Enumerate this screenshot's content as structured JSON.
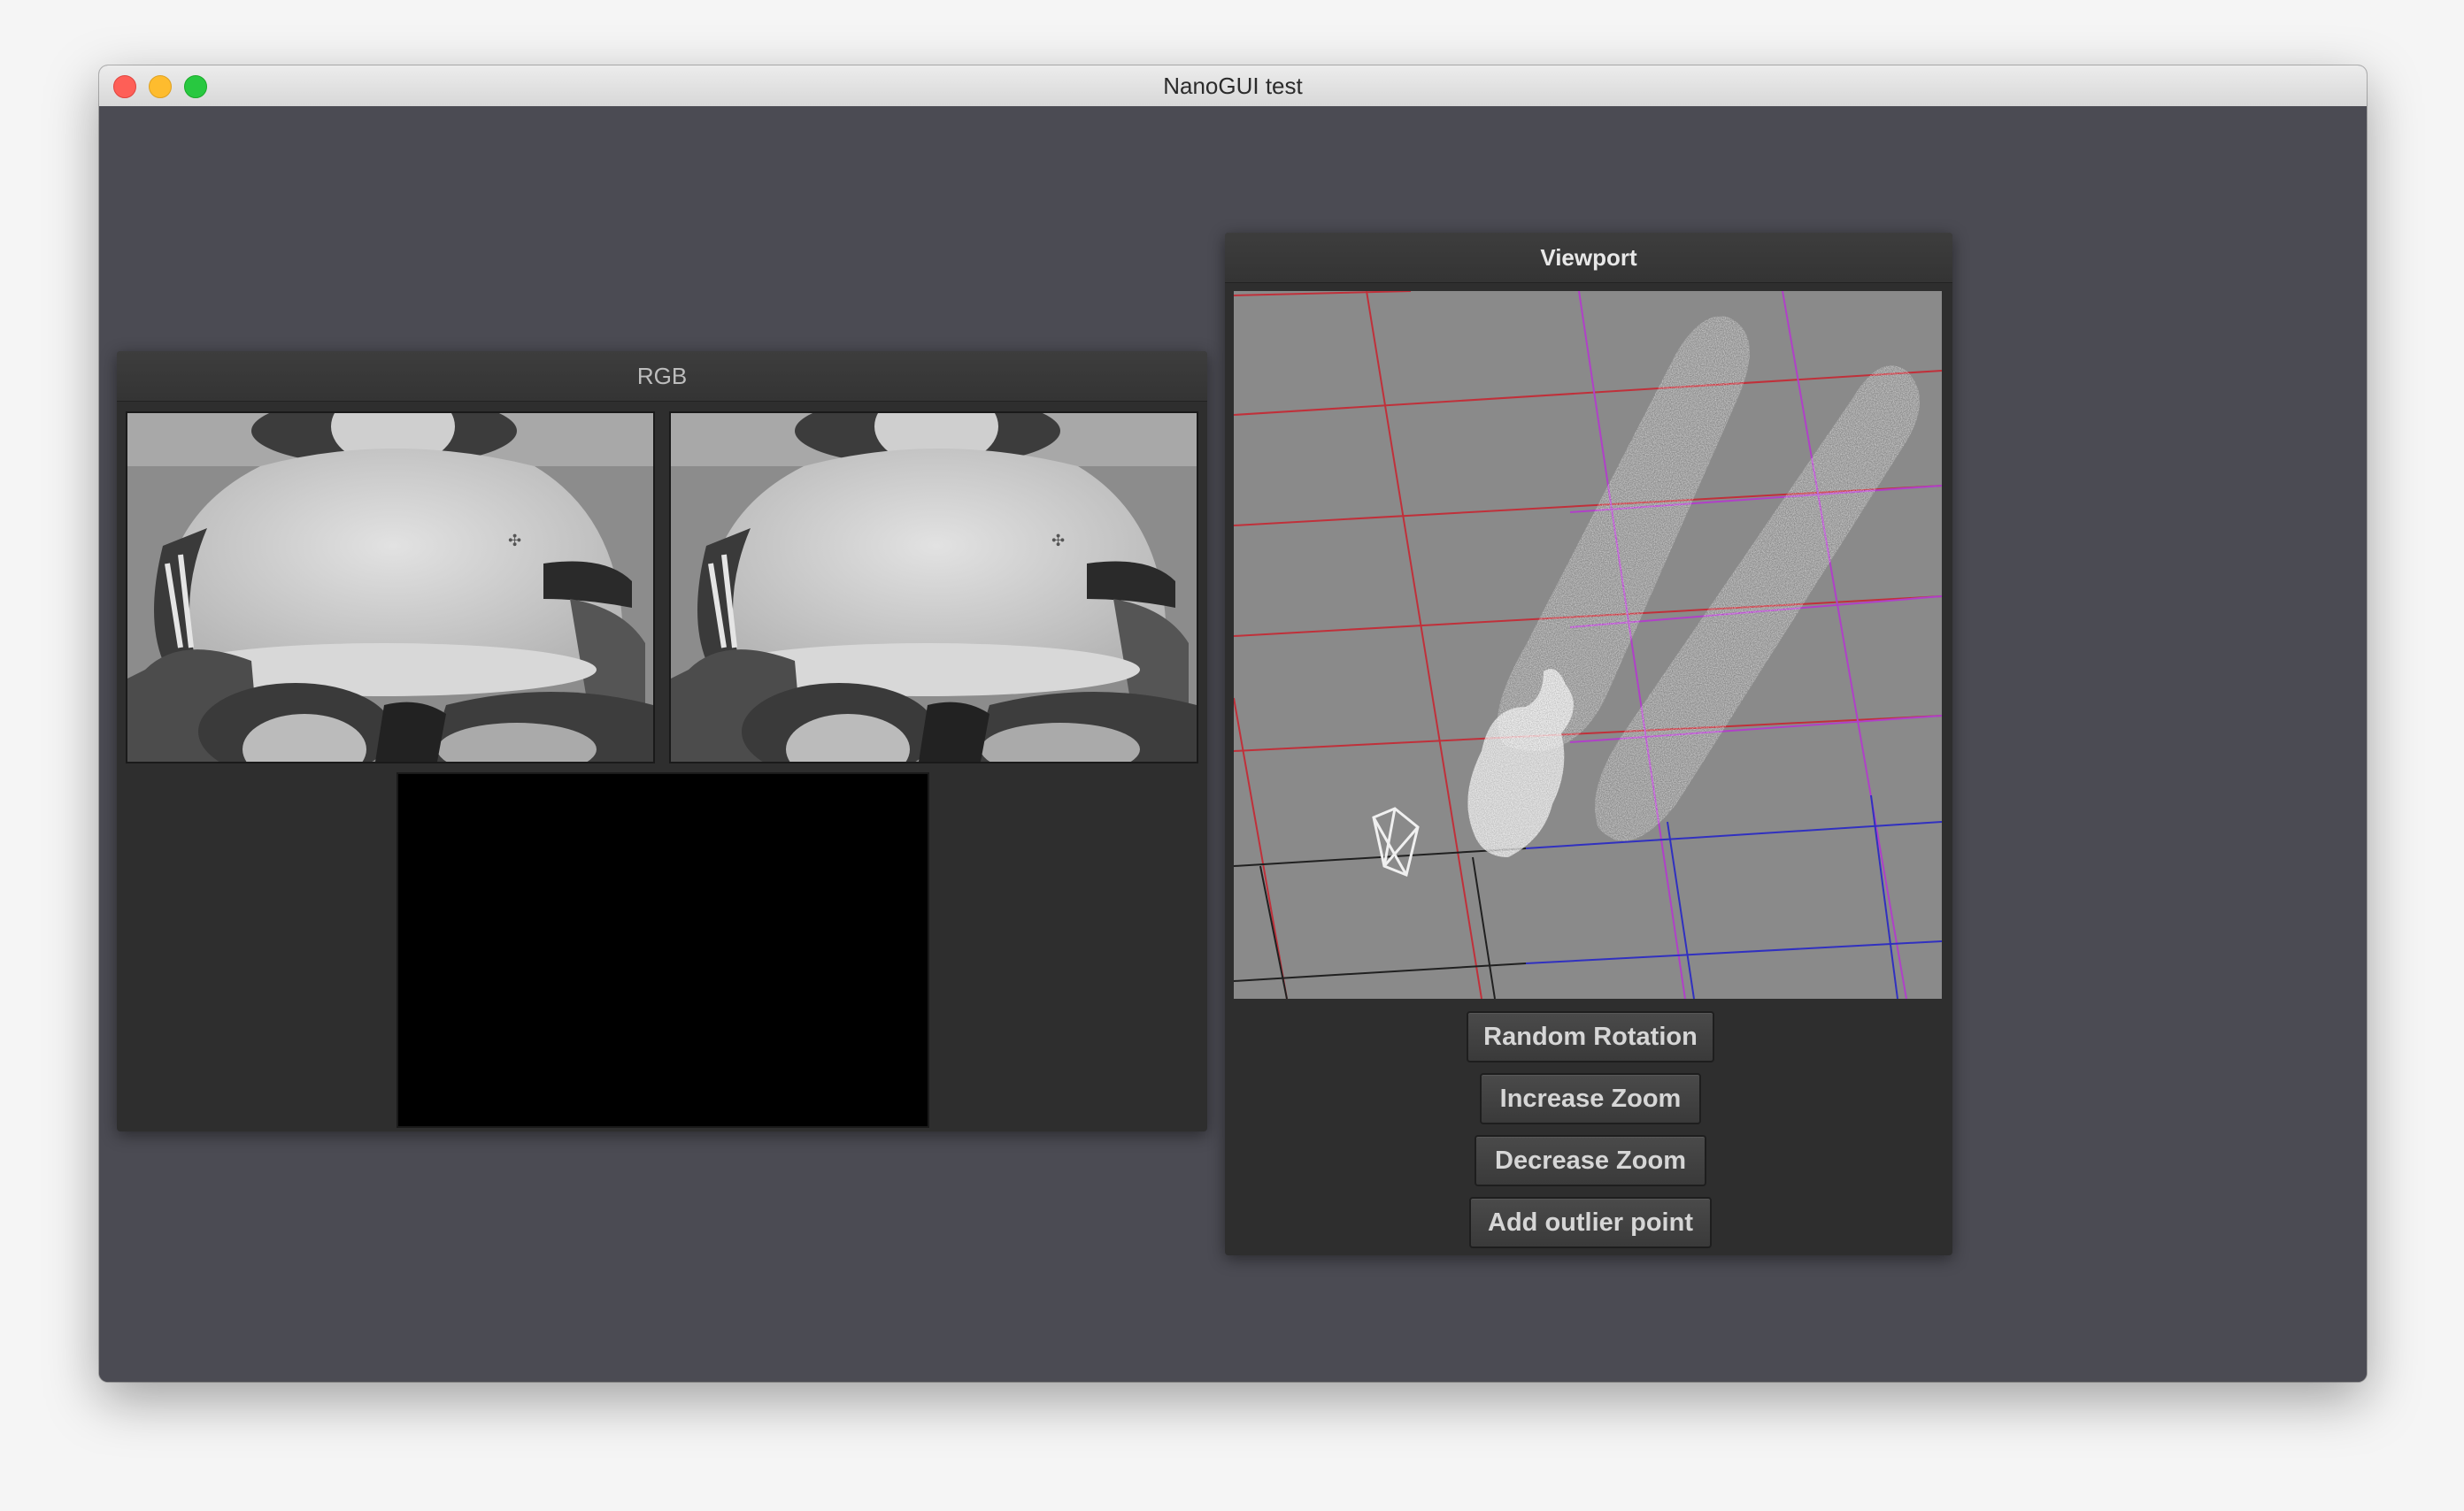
{
  "window": {
    "title": "NanoGUI test"
  },
  "rgb_panel": {
    "title": "RGB"
  },
  "viewport_panel": {
    "title": "Viewport",
    "buttons": {
      "random_rotation": "Random Rotation",
      "increase_zoom": "Increase Zoom",
      "decrease_zoom": "Decrease Zoom",
      "add_outlier": "Add outlier point"
    }
  },
  "colors": {
    "window_background": "#4b4b53",
    "panel_background": "#2e2e2e",
    "viewport_background": "#8a8a8a",
    "grid_red": "#c0303a",
    "grid_magenta": "#b040c8",
    "grid_blue": "#3030c0",
    "grid_black": "#202020",
    "close_button": "#fe5f57",
    "minimize_button": "#febc2e",
    "maximize_button": "#28c840"
  }
}
